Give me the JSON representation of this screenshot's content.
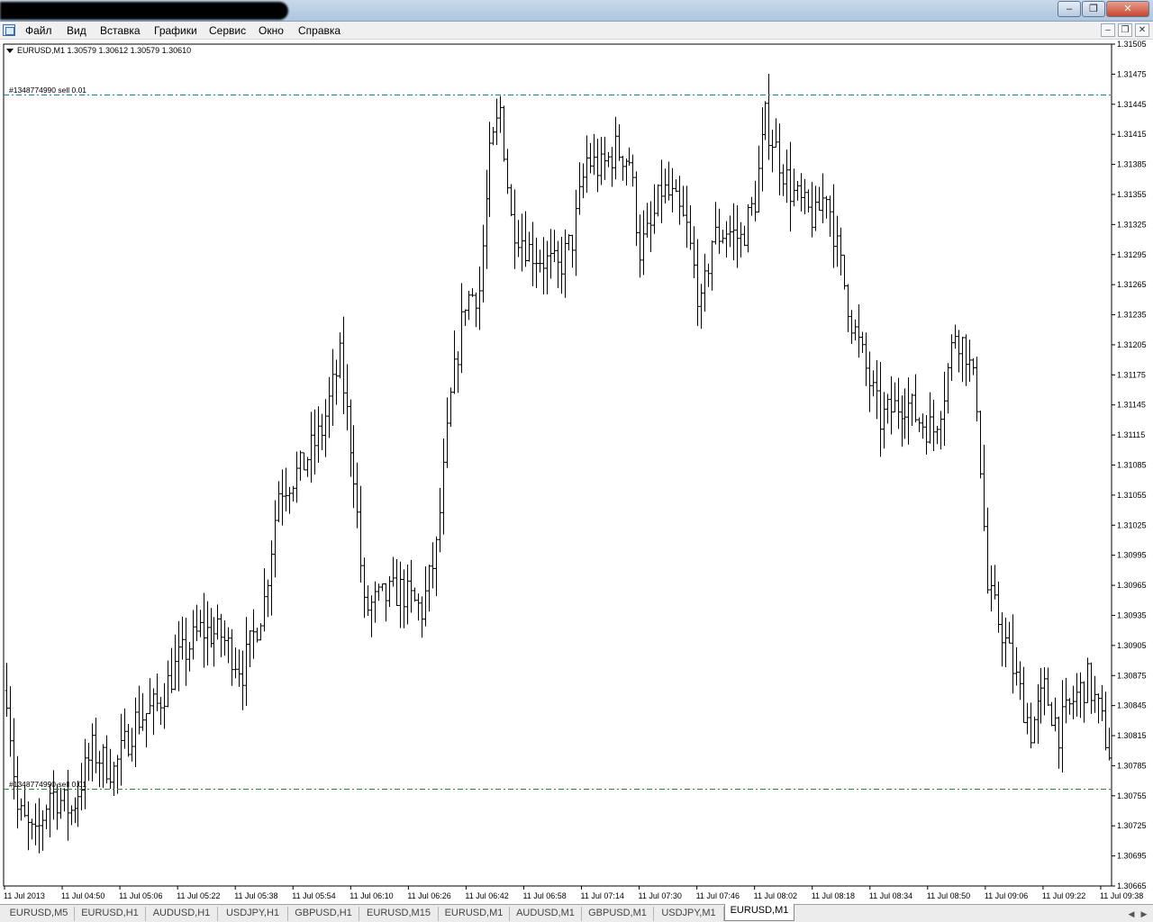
{
  "menu": {
    "items": [
      "Файл",
      "Вид",
      "Вставка",
      "Графики",
      "Сервис",
      "Окно",
      "Справка"
    ]
  },
  "window_controls": {
    "minimize": "–",
    "restore": "❐",
    "close": "✕",
    "mdi_minimize": "–",
    "mdi_restore": "❐",
    "mdi_close": "✕"
  },
  "chart": {
    "symbol_info": "EURUSD,M1  1.30579 1.30612 1.30579 1.30610",
    "orders": [
      {
        "label": "#1348774990 sell 0.01",
        "price": 1.31455,
        "color": "#0a8a8a"
      },
      {
        "label": "#1348774990 sell 0.01",
        "price": 1.30762,
        "color": "#1e8a3a"
      }
    ],
    "bar_color": "#000000",
    "grid": false
  },
  "chart_data": {
    "type": "ohlc",
    "symbol": "EURUSD",
    "timeframe": "M1",
    "ylim": [
      1.30665,
      1.31505
    ],
    "y_ticks": [
      "1.31505",
      "1.31475",
      "1.31445",
      "1.31415",
      "1.31385",
      "1.31355",
      "1.31325",
      "1.31295",
      "1.31265",
      "1.31235",
      "1.31205",
      "1.31175",
      "1.31145",
      "1.31115",
      "1.31085",
      "1.31055",
      "1.31025",
      "1.30995",
      "1.30965",
      "1.30935",
      "1.30905",
      "1.30875",
      "1.30845",
      "1.30815",
      "1.30785",
      "1.30755",
      "1.30725",
      "1.30695",
      "1.30665"
    ],
    "x_ticks": [
      "11 Jul 2013",
      "11 Jul 04:50",
      "11 Jul 05:06",
      "11 Jul 05:22",
      "11 Jul 05:38",
      "11 Jul 05:54",
      "11 Jul 06:10",
      "11 Jul 06:26",
      "11 Jul 06:42",
      "11 Jul 06:58",
      "11 Jul 07:14",
      "11 Jul 07:30",
      "11 Jul 07:46",
      "11 Jul 08:02",
      "11 Jul 08:18",
      "11 Jul 08:34",
      "11 Jul 08:50",
      "11 Jul 09:06",
      "11 Jul 09:22",
      "11 Jul 09:38"
    ],
    "price_path": [
      [
        0,
        1.3086
      ],
      [
        3,
        1.3074
      ],
      [
        8,
        1.3071
      ],
      [
        12,
        1.3076
      ],
      [
        18,
        1.3074
      ],
      [
        24,
        1.308
      ],
      [
        30,
        1.3078
      ],
      [
        36,
        1.3083
      ],
      [
        42,
        1.30845
      ],
      [
        48,
        1.3089
      ],
      [
        54,
        1.3092
      ],
      [
        60,
        1.30915
      ],
      [
        66,
        1.3088
      ],
      [
        72,
        1.3095
      ],
      [
        76,
        1.3106
      ],
      [
        82,
        1.3108
      ],
      [
        88,
        1.3112
      ],
      [
        93,
        1.3119
      ],
      [
        97,
        1.3108
      ],
      [
        100,
        1.3094
      ],
      [
        104,
        1.3095
      ],
      [
        110,
        1.3096
      ],
      [
        116,
        1.3094
      ],
      [
        120,
        1.31
      ],
      [
        124,
        1.3115
      ],
      [
        128,
        1.3125
      ],
      [
        132,
        1.3126
      ],
      [
        135,
        1.3139
      ],
      [
        138,
        1.3144
      ],
      [
        141,
        1.3133
      ],
      [
        146,
        1.313
      ],
      [
        150,
        1.3129
      ],
      [
        154,
        1.3128
      ],
      [
        158,
        1.3131
      ],
      [
        162,
        1.3139
      ],
      [
        166,
        1.3138
      ],
      [
        170,
        1.314
      ],
      [
        174,
        1.3139
      ],
      [
        177,
        1.313
      ],
      [
        180,
        1.3132
      ],
      [
        183,
        1.3136
      ],
      [
        186,
        1.3135
      ],
      [
        190,
        1.3132
      ],
      [
        194,
        1.3124
      ],
      [
        197,
        1.3131
      ],
      [
        201,
        1.3132
      ],
      [
        205,
        1.3131
      ],
      [
        209,
        1.3135
      ],
      [
        212,
        1.3143
      ],
      [
        215,
        1.314
      ],
      [
        219,
        1.3136
      ],
      [
        223,
        1.3134
      ],
      [
        226,
        1.3133
      ],
      [
        229,
        1.3136
      ],
      [
        232,
        1.313
      ],
      [
        236,
        1.3123
      ],
      [
        240,
        1.3118
      ],
      [
        244,
        1.3113
      ],
      [
        247,
        1.3114
      ],
      [
        251,
        1.3115
      ],
      [
        255,
        1.3113
      ],
      [
        259,
        1.3112
      ],
      [
        262,
        1.3116
      ],
      [
        265,
        1.3122
      ],
      [
        268,
        1.312
      ],
      [
        271,
        1.3115
      ],
      [
        274,
        1.3096
      ],
      [
        278,
        1.3092
      ],
      [
        282,
        1.3087
      ],
      [
        286,
        1.3082
      ],
      [
        290,
        1.3086
      ],
      [
        294,
        1.3082
      ],
      [
        298,
        1.3085
      ],
      [
        302,
        1.3087
      ],
      [
        305,
        1.3084
      ],
      [
        308,
        1.308
      ]
    ]
  },
  "tabs": [
    "EURUSD,M5",
    "EURUSD,H1",
    "AUDUSD,H1",
    "USDJPY,H1",
    "GBPUSD,H1",
    "EURUSD,M15",
    "EURUSD,M1",
    "AUDUSD,M1",
    "GBPUSD,M1",
    "USDJPY,M1",
    "EURUSD,M1"
  ],
  "active_tab_index": 10
}
